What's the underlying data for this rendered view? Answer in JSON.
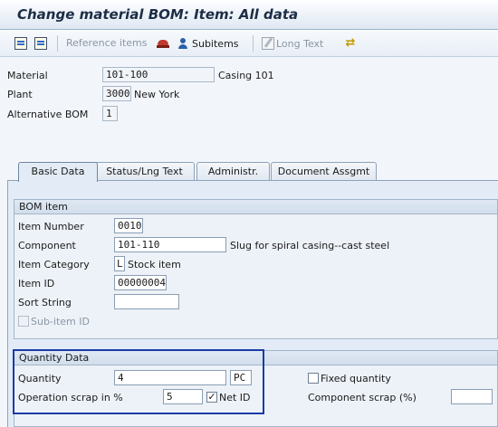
{
  "window": {
    "title": "Change material BOM: Item: All data"
  },
  "toolbar": {
    "reference_items": "Reference items",
    "subitems": "Subitems",
    "long_text": "Long Text"
  },
  "header": {
    "material_label": "Material",
    "material_value": "101-100",
    "material_desc": "Casing 101",
    "plant_label": "Plant",
    "plant_value": "3000",
    "plant_desc": "New York",
    "alt_bom_label": "Alternative BOM",
    "alt_bom_value": "1"
  },
  "tabs": [
    {
      "label": "Basic Data",
      "active": true
    },
    {
      "label": "Status/Lng Text",
      "active": false
    },
    {
      "label": "Administr.",
      "active": false
    },
    {
      "label": "Document Assgmt",
      "active": false
    }
  ],
  "bom_item": {
    "title": "BOM item",
    "item_number_label": "Item Number",
    "item_number_value": "0010",
    "component_label": "Component",
    "component_value": "101-110",
    "component_desc": "Slug for spiral casing--cast steel",
    "item_category_label": "Item Category",
    "item_category_value": "L",
    "item_category_desc": "Stock item",
    "item_id_label": "Item ID",
    "item_id_value": "00000004",
    "sort_string_label": "Sort String",
    "sort_string_value": "",
    "sub_item_id_label": "Sub-item ID",
    "sub_item_id_checked": false
  },
  "quantity_data": {
    "title": "Quantity Data",
    "quantity_label": "Quantity",
    "quantity_value": "4",
    "unit_value": "PC",
    "fixed_quantity_label": "Fixed quantity",
    "fixed_quantity_checked": false,
    "op_scrap_label": "Operation scrap in %",
    "op_scrap_value": "5",
    "net_id_label": "Net ID",
    "net_id_checked": true,
    "component_scrap_label": "Component scrap (%)",
    "component_scrap_value": ""
  },
  "colors": {
    "highlight": "#1b3aa6",
    "panel": "#e3ecf6"
  }
}
